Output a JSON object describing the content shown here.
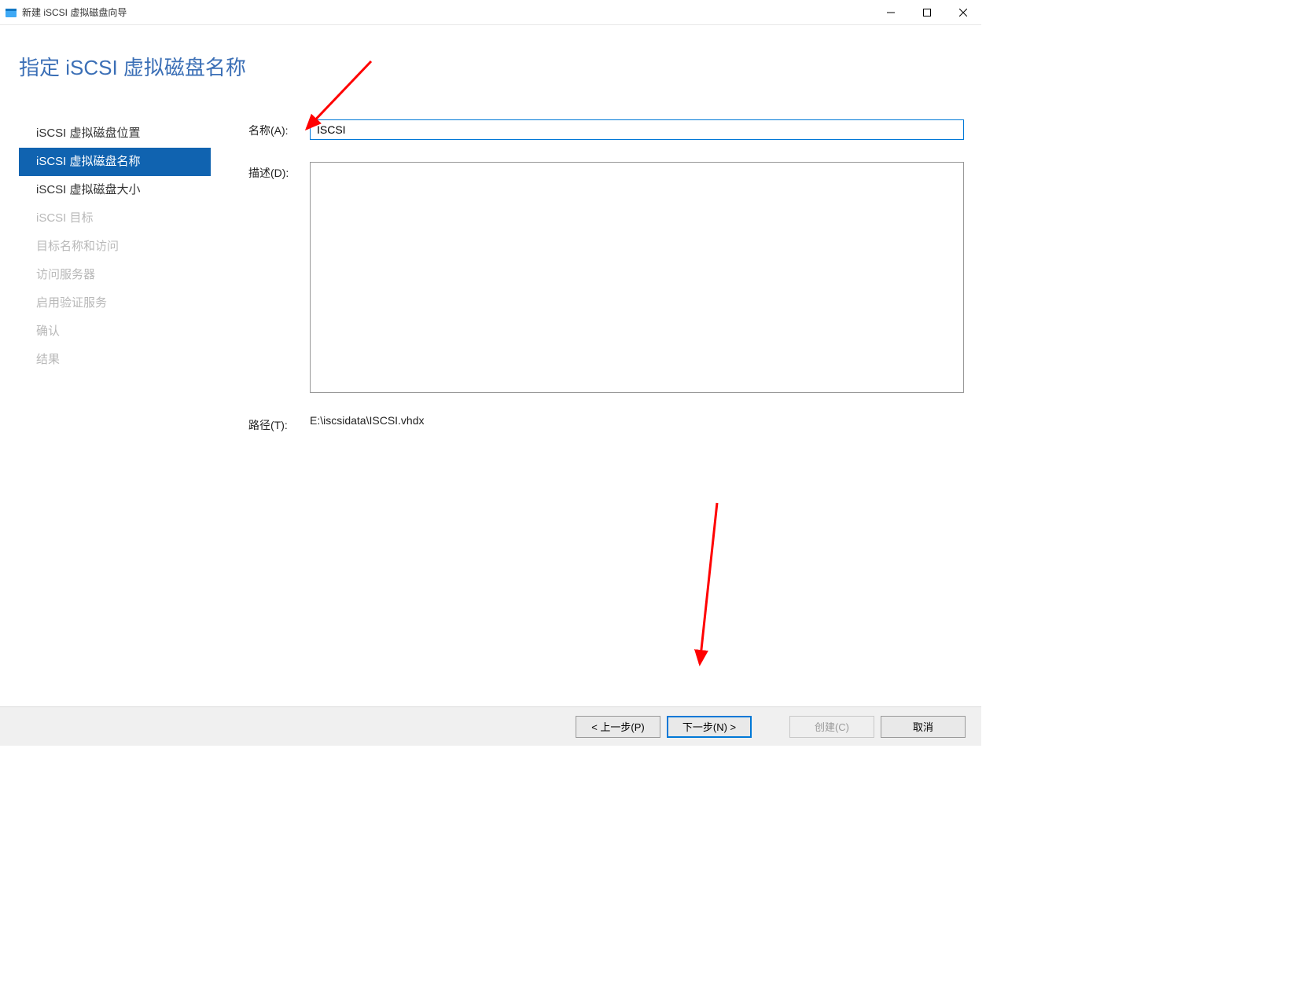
{
  "window": {
    "title": "新建 iSCSI 虚拟磁盘向导"
  },
  "page_title": "指定 iSCSI 虚拟磁盘名称",
  "sidebar": {
    "items": [
      {
        "label": "iSCSI 虚拟磁盘位置",
        "state": "enabled"
      },
      {
        "label": "iSCSI 虚拟磁盘名称",
        "state": "active"
      },
      {
        "label": "iSCSI 虚拟磁盘大小",
        "state": "enabled"
      },
      {
        "label": "iSCSI 目标",
        "state": "disabled"
      },
      {
        "label": "目标名称和访问",
        "state": "disabled"
      },
      {
        "label": "访问服务器",
        "state": "disabled"
      },
      {
        "label": "启用验证服务",
        "state": "disabled"
      },
      {
        "label": "确认",
        "state": "disabled"
      },
      {
        "label": "结果",
        "state": "disabled"
      }
    ]
  },
  "form": {
    "name_label": "名称(A):",
    "name_value": "ISCSI",
    "desc_label": "描述(D):",
    "desc_value": "",
    "path_label": "路径(T):",
    "path_value": "E:\\iscsidata\\ISCSI.vhdx"
  },
  "buttons": {
    "prev": "< 上一步(P)",
    "next": "下一步(N) >",
    "create": "创建(C)",
    "cancel": "取消"
  }
}
